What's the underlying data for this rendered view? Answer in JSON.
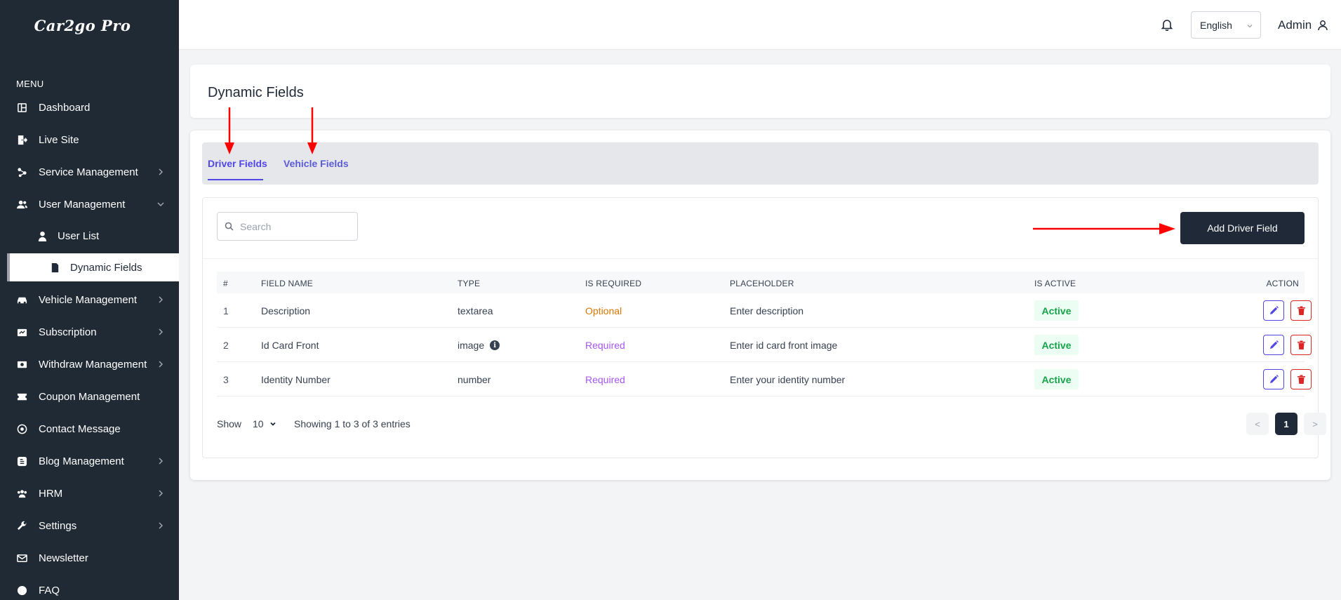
{
  "brand": "Car2go Pro",
  "sidebar": {
    "menu_title": "MENU",
    "items": [
      {
        "label": "Dashboard",
        "icon": "dashboard-icon"
      },
      {
        "label": "Live Site",
        "icon": "door-exit-icon"
      },
      {
        "label": "Service Management",
        "icon": "services-icon",
        "chevron": "right"
      },
      {
        "label": "User Management",
        "icon": "users-icon",
        "chevron": "down"
      },
      {
        "label": "User List",
        "icon": "user-icon",
        "sub": true
      },
      {
        "label": "Dynamic Fields",
        "icon": "file-icon",
        "sub": true,
        "active": true
      },
      {
        "label": "Vehicle Management",
        "icon": "car-icon",
        "chevron": "right"
      },
      {
        "label": "Subscription",
        "icon": "subscription-icon",
        "chevron": "right"
      },
      {
        "label": "Withdraw Management",
        "icon": "withdraw-icon",
        "chevron": "right"
      },
      {
        "label": "Coupon Management",
        "icon": "coupon-icon"
      },
      {
        "label": "Contact Message",
        "icon": "message-icon"
      },
      {
        "label": "Blog Management",
        "icon": "blog-icon",
        "chevron": "right"
      },
      {
        "label": "HRM",
        "icon": "team-icon",
        "chevron": "right"
      },
      {
        "label": "Settings",
        "icon": "wrench-icon",
        "chevron": "right"
      },
      {
        "label": "Newsletter",
        "icon": "mail-icon"
      },
      {
        "label": "FAQ",
        "icon": "question-icon"
      }
    ]
  },
  "topbar": {
    "language": "English",
    "user": "Admin"
  },
  "page": {
    "title": "Dynamic Fields",
    "tabs": [
      {
        "label": "Driver Fields",
        "active": true
      },
      {
        "label": "Vehicle Fields",
        "active": false
      }
    ],
    "search_placeholder": "Search",
    "add_button": "Add Driver Field"
  },
  "table": {
    "headers": [
      "#",
      "FIELD NAME",
      "TYPE",
      "IS REQUIRED",
      "PLACEHOLDER",
      "IS ACTIVE",
      "ACTION"
    ],
    "rows": [
      {
        "num": "1",
        "name": "Description",
        "type": "textarea",
        "required": "Optional",
        "placeholder": "Enter description",
        "active": "Active",
        "info": false
      },
      {
        "num": "2",
        "name": "Id Card Front",
        "type": "image",
        "required": "Required",
        "placeholder": "Enter id card front image",
        "active": "Active",
        "info": true
      },
      {
        "num": "3",
        "name": "Identity Number",
        "type": "number",
        "required": "Required",
        "placeholder": "Enter your identity number",
        "active": "Active",
        "info": false
      }
    ]
  },
  "footer": {
    "show_label": "Show",
    "page_size": "10",
    "summary": "Showing 1 to 3 of 3 entries",
    "prev": "<",
    "current_page": "1",
    "next": ">"
  },
  "colors": {
    "sidebar_bg": "#1f2a35",
    "accent": "#4f46e5",
    "annotation_arrow": "#ff0000"
  }
}
